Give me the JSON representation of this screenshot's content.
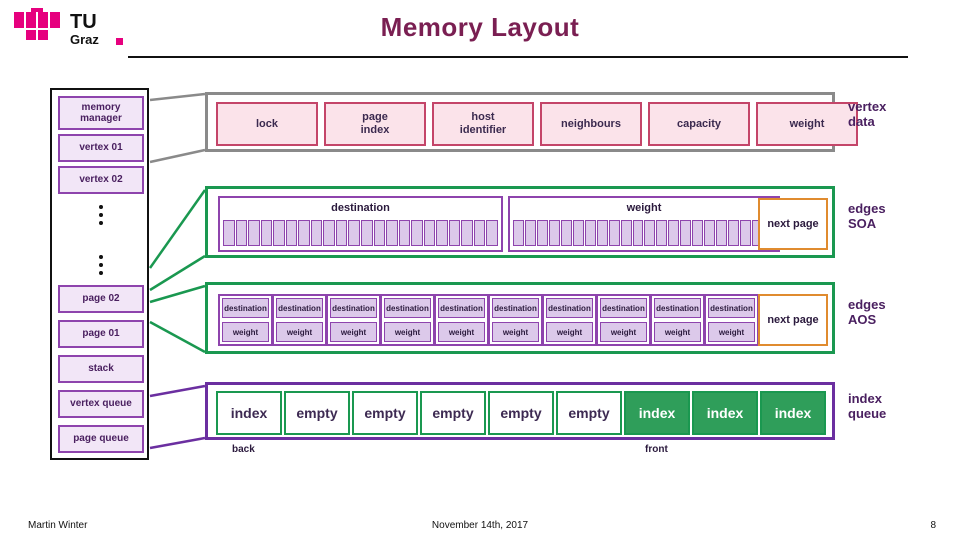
{
  "header": {
    "title": "Memory Layout",
    "logo_text_top": "TU",
    "logo_text_bottom": "Graz"
  },
  "footer": {
    "author": "Martin Winter",
    "date": "November 14th, 2017",
    "page": "8"
  },
  "memory_manager": {
    "items": [
      {
        "label": "memory\nmanager"
      },
      {
        "label": "vertex 01"
      },
      {
        "label": "vertex 02"
      },
      {
        "label": "page 02"
      },
      {
        "label": "page 01"
      },
      {
        "label": "stack"
      },
      {
        "label": "vertex queue"
      },
      {
        "label": "page queue"
      }
    ]
  },
  "vertex_data": {
    "group_label": "vertex\ndata",
    "fields": [
      "lock",
      "page\nindex",
      "host\nidentifier",
      "neighbours",
      "capacity",
      "weight"
    ]
  },
  "edges_soa": {
    "group_label": "edges\nSOA",
    "blocks": [
      "destination",
      "weight"
    ],
    "next_page_label": "next page",
    "destination_slots": 22,
    "weight_slots": 22
  },
  "edges_aos": {
    "group_label": "edges\nAOS",
    "cell_top_label": "destination",
    "cell_bottom_label": "weight",
    "cell_count": 10,
    "next_page_label": "next page"
  },
  "index_queue": {
    "group_label": "index\nqueue",
    "cells": [
      "index",
      "empty",
      "empty",
      "empty",
      "empty",
      "empty",
      "index",
      "index",
      "index"
    ],
    "filled_flags": [
      false,
      false,
      false,
      false,
      false,
      false,
      true,
      true,
      true
    ],
    "back_label": "back",
    "front_label": "front"
  },
  "colors": {
    "title": "#7a1f52",
    "purple": "#8e44ad",
    "green": "#1a9850",
    "grey": "#8a8a8a",
    "orange": "#e08b2f",
    "pink": "#c44569",
    "queue_fill": "#2f9e5a"
  }
}
